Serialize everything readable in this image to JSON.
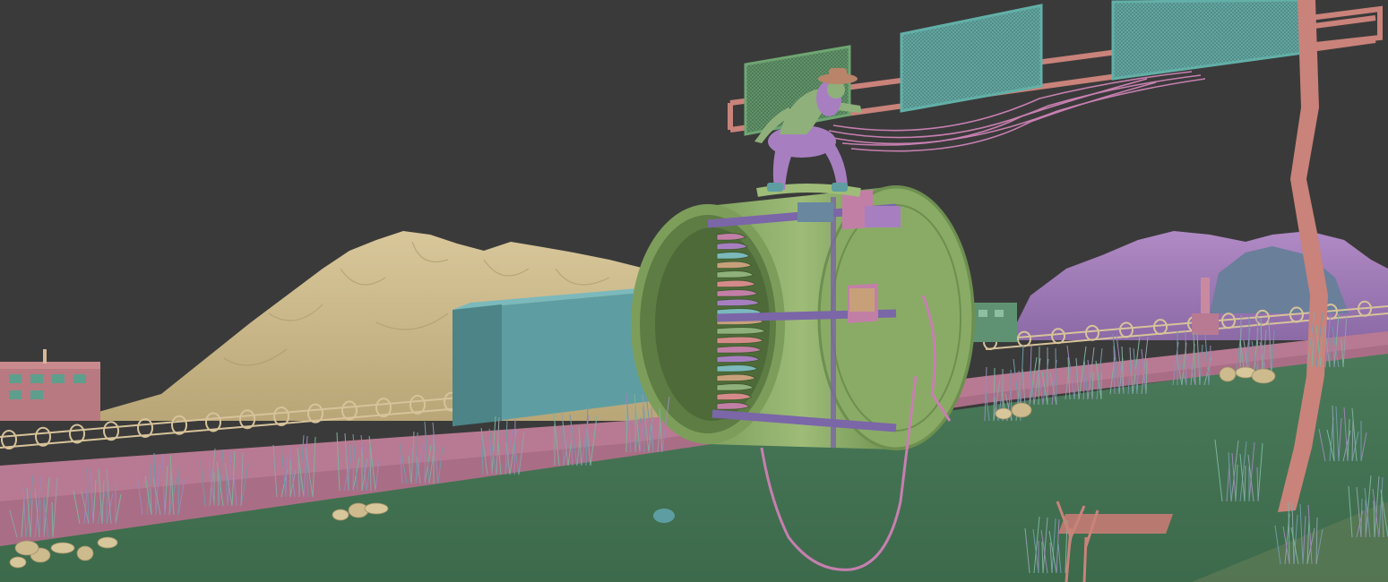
{
  "viewport": {
    "background_color": "#3a3a3a",
    "ground_color": "#3f6b4e",
    "palette": {
      "sand_mountain": "#cdbb8d",
      "purple_mountain": "#a07fb8",
      "blue_rock": "#6a7f9a",
      "pink_wall": "#b87a92",
      "turbine_green": "#8fae6b",
      "turbine_violet": "#7b66a8",
      "teal_block": "#5e9ea2",
      "billboard_teal": "#5f9e9a",
      "pole_salmon": "#c9837a",
      "cable_pink": "#c77fb0",
      "figure_green": "#8fb07a",
      "figure_purple": "#a77fc0",
      "hat_brown": "#b9846a"
    },
    "objects": [
      "sand-mountain",
      "purple-mountain",
      "blue-rock",
      "pink-wall",
      "fence",
      "left-building",
      "teal-block",
      "jet-turbine",
      "billboards",
      "signpost",
      "cables",
      "character-figure",
      "grass-clumps",
      "rocks"
    ]
  }
}
